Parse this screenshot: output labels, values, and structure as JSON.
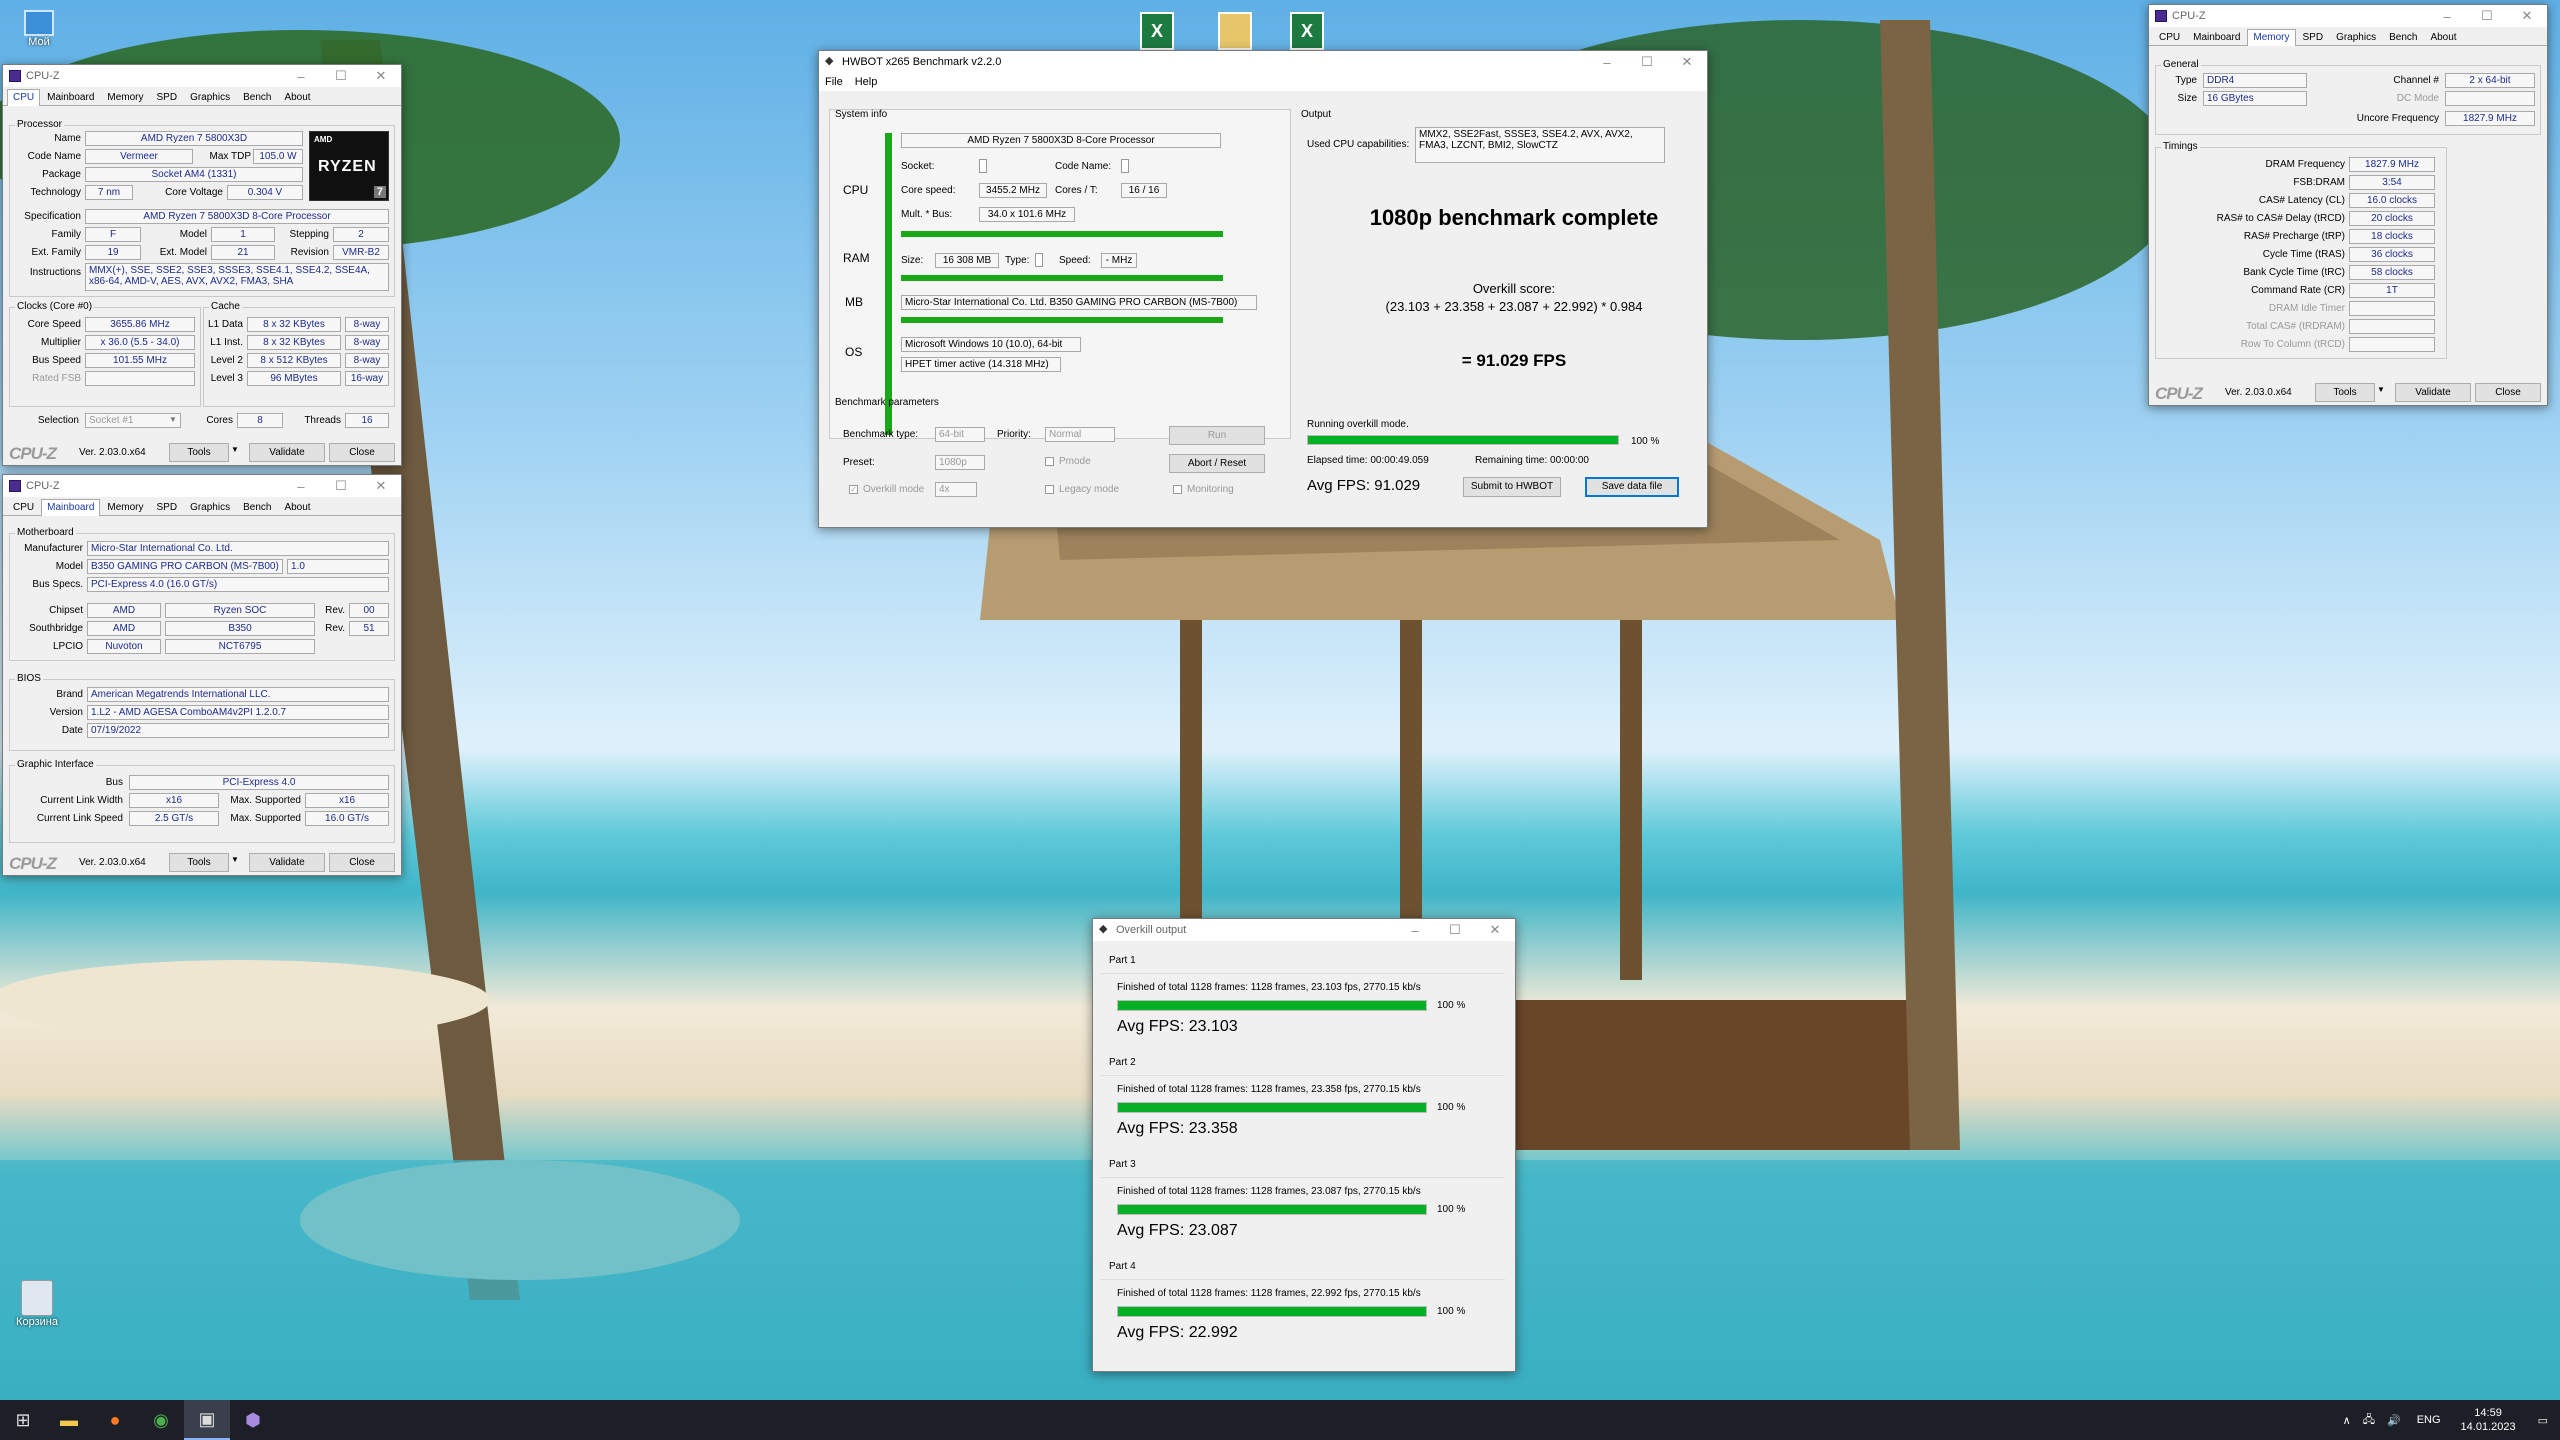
{
  "desktop": {
    "recycle_label": "Корзина",
    "top_icon_label": "Мой"
  },
  "cpuz_cpu": {
    "title": "CPU-Z",
    "tabs": [
      "CPU",
      "Mainboard",
      "Memory",
      "SPD",
      "Graphics",
      "Bench",
      "About"
    ],
    "processor_group": "Processor",
    "name_lbl": "Name",
    "name": "AMD Ryzen 7 5800X3D",
    "codename_lbl": "Code Name",
    "codename": "Vermeer",
    "maxtdp_lbl": "Max TDP",
    "maxtdp": "105.0 W",
    "package_lbl": "Package",
    "package": "Socket AM4 (1331)",
    "tech_lbl": "Technology",
    "tech": "7 nm",
    "corev_lbl": "Core Voltage",
    "corev": "0.304 V",
    "spec_lbl": "Specification",
    "spec": "AMD Ryzen 7 5800X3D 8-Core Processor",
    "family_lbl": "Family",
    "family": "F",
    "model_lbl": "Model",
    "model": "1",
    "stepping_lbl": "Stepping",
    "stepping": "2",
    "extfamily_lbl": "Ext. Family",
    "extfamily": "19",
    "extmodel_lbl": "Ext. Model",
    "extmodel": "21",
    "revision_lbl": "Revision",
    "revision": "VMR-B2",
    "instr_lbl": "Instructions",
    "instr": "MMX(+), SSE, SSE2, SSE3, SSSE3, SSE4.1, SSE4.2, SSE4A, x86-64, AMD-V, AES, AVX, AVX2, FMA3, SHA",
    "clocks_group": "Clocks (Core #0)",
    "corespeed_lbl": "Core Speed",
    "corespeed": "3655.86 MHz",
    "mult_lbl": "Multiplier",
    "mult": "x 36.0 (5.5 - 34.0)",
    "bus_lbl": "Bus Speed",
    "bus": "101.55 MHz",
    "ratedfsb_lbl": "Rated FSB",
    "cache_group": "Cache",
    "l1d_lbl": "L1 Data",
    "l1d": "8 x 32 KBytes",
    "l1d_w": "8-way",
    "l1i_lbl": "L1 Inst.",
    "l1i": "8 x 32 KBytes",
    "l1i_w": "8-way",
    "l2_lbl": "Level 2",
    "l2": "8 x 512 KBytes",
    "l2_w": "8-way",
    "l3_lbl": "Level 3",
    "l3": "96 MBytes",
    "l3_w": "16-way",
    "selection_lbl": "Selection",
    "selection": "Socket #1",
    "cores_lbl": "Cores",
    "cores": "8",
    "threads_lbl": "Threads",
    "threads": "16",
    "logo_brand": "RYZEN",
    "logo_num": "7",
    "logo_amd": "AMD"
  },
  "cpuz_common": {
    "brand": "CPU-Z",
    "version": "Ver. 2.03.0.x64",
    "tools": "Tools",
    "validate": "Validate",
    "close": "Close"
  },
  "cpuz_mb": {
    "title": "CPU-Z",
    "mb_group": "Motherboard",
    "manu_lbl": "Manufacturer",
    "manu": "Micro-Star International Co. Ltd.",
    "model_lbl": "Model",
    "model": "B350 GAMING PRO CARBON (MS-7B00)",
    "model_rev": "1.0",
    "busspecs_lbl": "Bus Specs.",
    "busspecs": "PCI-Express 4.0 (16.0 GT/s)",
    "chipset_lbl": "Chipset",
    "chipset": "AMD",
    "chipset_name": "Ryzen SOC",
    "chipset_rev_lbl": "Rev.",
    "chipset_rev": "00",
    "south_lbl": "Southbridge",
    "south": "AMD",
    "south_name": "B350",
    "south_rev_lbl": "Rev.",
    "south_rev": "51",
    "lpcio_lbl": "LPCIO",
    "lpcio": "Nuvoton",
    "lpcio_name": "NCT6795",
    "bios_group": "BIOS",
    "brand_lbl": "Brand",
    "brand": "American Megatrends International LLC.",
    "version_lbl": "Version",
    "version": "1.L2 - AMD AGESA ComboAM4v2PI 1.2.0.7",
    "date_lbl": "Date",
    "date": "07/19/2022",
    "gi_group": "Graphic Interface",
    "gbus_lbl": "Bus",
    "gbus": "PCI-Express 4.0",
    "clw_lbl": "Current Link Width",
    "clw": "x16",
    "msw_lbl": "Max. Supported",
    "msw": "x16",
    "cls_lbl": "Current Link Speed",
    "cls": "2.5 GT/s",
    "mss_lbl": "Max. Supported",
    "mss": "16.0 GT/s"
  },
  "cpuz_mem": {
    "title": "CPU-Z",
    "general_group": "General",
    "type_lbl": "Type",
    "type": "DDR4",
    "channel_lbl": "Channel #",
    "channel": "2 x 64-bit",
    "size_lbl": "Size",
    "size": "16 GBytes",
    "dcmode_lbl": "DC Mode",
    "uncore_lbl": "Uncore Frequency",
    "uncore": "1827.9 MHz",
    "timings_group": "Timings",
    "dram_lbl": "DRAM Frequency",
    "dram": "1827.9 MHz",
    "fsb_lbl": "FSB:DRAM",
    "fsb": "3:54",
    "cl_lbl": "CAS# Latency (CL)",
    "cl": "16.0 clocks",
    "trcd_lbl": "RAS# to CAS# Delay (tRCD)",
    "trcd": "20 clocks",
    "trp_lbl": "RAS# Precharge (tRP)",
    "trp": "18 clocks",
    "tras_lbl": "Cycle Time (tRAS)",
    "tras": "36 clocks",
    "trc_lbl": "Bank Cycle Time (tRC)",
    "trc": "58 clocks",
    "cr_lbl": "Command Rate (CR)",
    "cr": "1T",
    "idle_lbl": "DRAM Idle Timer",
    "trdram_lbl": "Total CAS# (tRDRAM)",
    "rtc_lbl": "Row To Column (tRCD)"
  },
  "hwbot": {
    "title": "HWBOT x265 Benchmark v2.2.0",
    "menu": [
      "File",
      "Help"
    ],
    "sysinfo": "System info",
    "output": "Output",
    "cpu_lbl": "CPU",
    "ram_lbl": "RAM",
    "mb_lbl": "MB",
    "os_lbl": "OS",
    "cpu_name": "AMD Ryzen 7 5800X3D 8-Core Processor",
    "socket_lbl": "Socket:",
    "codename_lbl": "Code Name:",
    "corespeed_lbl": "Core speed:",
    "corespeed": "3455.2 MHz",
    "coresT_lbl": "Cores / T:",
    "coresT": "16 / 16",
    "multbus_lbl": "Mult. * Bus:",
    "multbus": "34.0 x 101.6 MHz",
    "size_lbl": "Size:",
    "size": "16 308 MB",
    "type_lbl": "Type:",
    "speed_lbl": "Speed:",
    "speed": "- MHz",
    "mb": "Micro-Star International Co. Ltd. B350 GAMING PRO CARBON (MS-7B00)",
    "os": "Microsoft Windows 10 (10.0), 64-bit",
    "hpet": "HPET timer active (14.318 MHz)",
    "caps_lbl": "Used CPU capabilities:",
    "caps": "MMX2, SSE2Fast, SSSE3, SSE4.2, AVX, AVX2, FMA3, LZCNT, BMI2, SlowCTZ",
    "headline": "1080p benchmark complete",
    "score_lbl": "Overkill score:",
    "score_formula": "(23.103 + 23.358 + 23.087 + 22.992) * 0.984",
    "score": "= 91.029 FPS",
    "params": "Benchmark parameters",
    "btype_lbl": "Benchmark type:",
    "btype": "64-bit",
    "priority_lbl": "Priority:",
    "priority": "Normal",
    "run": "Run",
    "preset_lbl": "Preset:",
    "preset": "1080p",
    "pmode": "Pmode",
    "abort": "Abort / Reset",
    "overkill_lbl": "Overkill mode",
    "overkill": "4x",
    "legacy": "Legacy mode",
    "monitoring": "Monitoring",
    "running": "Running overkill mode.",
    "progress": 1.0,
    "progress_txt": "100 %",
    "elapsed": "Elapsed time: 00:00:49.059",
    "remaining": "Remaining time: 00:00:00",
    "avg": "Avg FPS: 91.029",
    "submit": "Submit to HWBOT",
    "save": "Save data file"
  },
  "overkill": {
    "title": "Overkill output",
    "parts": [
      {
        "label": "Part 1",
        "line": "Finished of total 1128 frames: 1128 frames, 23.103 fps,  2770.15 kb/s",
        "pct": "100 %",
        "progress": 1.0,
        "avg": "Avg FPS: 23.103"
      },
      {
        "label": "Part 2",
        "line": "Finished of total 1128 frames: 1128 frames, 23.358 fps,  2770.15 kb/s",
        "pct": "100 %",
        "progress": 1.0,
        "avg": "Avg FPS: 23.358"
      },
      {
        "label": "Part 3",
        "line": "Finished of total 1128 frames: 1128 frames, 23.087 fps,  2770.15 kb/s",
        "pct": "100 %",
        "progress": 1.0,
        "avg": "Avg FPS: 23.087"
      },
      {
        "label": "Part 4",
        "line": "Finished of total 1128 frames: 1128 frames, 22.992 fps,  2770.15 kb/s",
        "pct": "100 %",
        "progress": 1.0,
        "avg": "Avg FPS: 22.992"
      }
    ]
  },
  "taskbar": {
    "lang": "ENG",
    "time": "14:59",
    "date": "14.01.2023"
  }
}
